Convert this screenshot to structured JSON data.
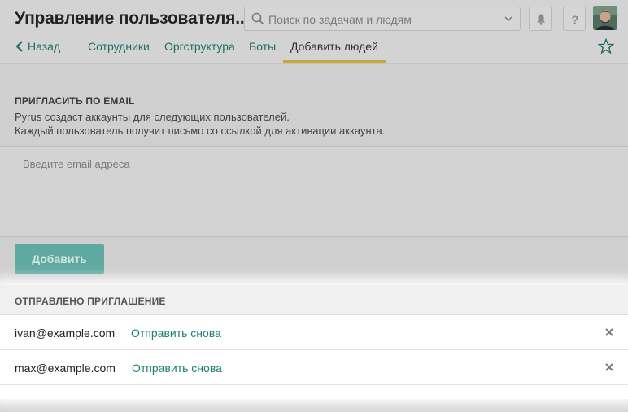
{
  "header": {
    "title": "Управление пользователя...",
    "search_placeholder": "Поиск по задачам и людям"
  },
  "nav": {
    "back_label": "Назад",
    "tabs": [
      {
        "label": "Сотрудники"
      },
      {
        "label": "Оргструктура"
      },
      {
        "label": "Боты"
      },
      {
        "label": "Добавить людей"
      }
    ]
  },
  "invite": {
    "title": "ПРИГЛАСИТЬ ПО EMAIL",
    "desc_line1": "Pyrus создаст аккаунты для следующих пользователей.",
    "desc_line2": "Каждый пользователь получит письмо со ссылкой для активации аккаунта.",
    "email_placeholder": "Введите email адреса",
    "add_button": "Добавить"
  },
  "sent": {
    "title": "ОТПРАВЛЕНО ПРИГЛАШЕНИЕ",
    "rows": [
      {
        "email": "ivan@example.com",
        "action": "Отправить снова"
      },
      {
        "email": "max@example.com",
        "action": "Отправить снова"
      }
    ]
  },
  "colors": {
    "accent": "#1e7d74",
    "button": "#5fa9a1",
    "tab_underline": "#c9a93a"
  }
}
